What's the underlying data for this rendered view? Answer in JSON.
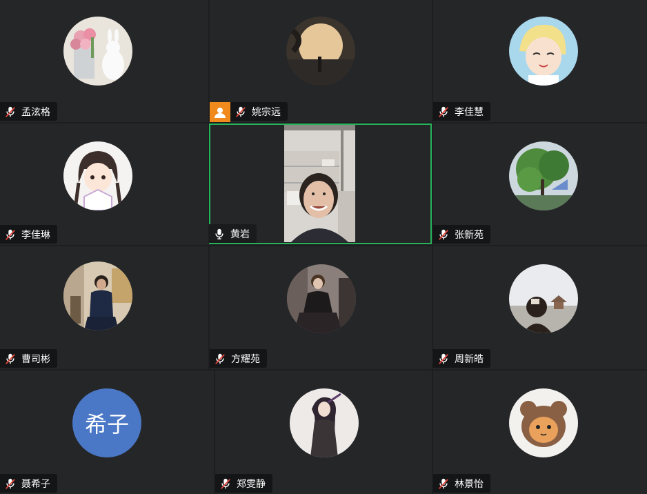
{
  "colors": {
    "active_speaker_border": "#27b35a",
    "host_badge": "#f08a1c",
    "tile_bg": "#252628",
    "name_tag_bg": "#141516",
    "text_avatar_bg": "#4a78c6"
  },
  "participants": [
    {
      "name": "孟泫格",
      "mic": "muted-mic-icon"
    },
    {
      "name": "姚宗远",
      "mic": "muted-mic-icon",
      "host": true
    },
    {
      "name": "李佳慧",
      "mic": "muted-mic-icon"
    },
    {
      "name": "李佳琳",
      "mic": "muted-mic-icon"
    },
    {
      "name": "黄岩",
      "mic": "mic-icon",
      "active_speaker": true,
      "video_on": true
    },
    {
      "name": "张新苑",
      "mic": "muted-mic-icon"
    },
    {
      "name": "曹司彬",
      "mic": "muted-mic-icon"
    },
    {
      "name": "方耀苑",
      "mic": "muted-mic-icon"
    },
    {
      "name": "周新皓",
      "mic": "muted-mic-icon"
    },
    {
      "name": "聂希子",
      "mic": "muted-mic-icon",
      "avatar_text": "希子"
    },
    {
      "name": "郑雯静",
      "mic": "muted-mic-icon"
    },
    {
      "name": "林景怡",
      "mic": "muted-mic-icon"
    }
  ]
}
